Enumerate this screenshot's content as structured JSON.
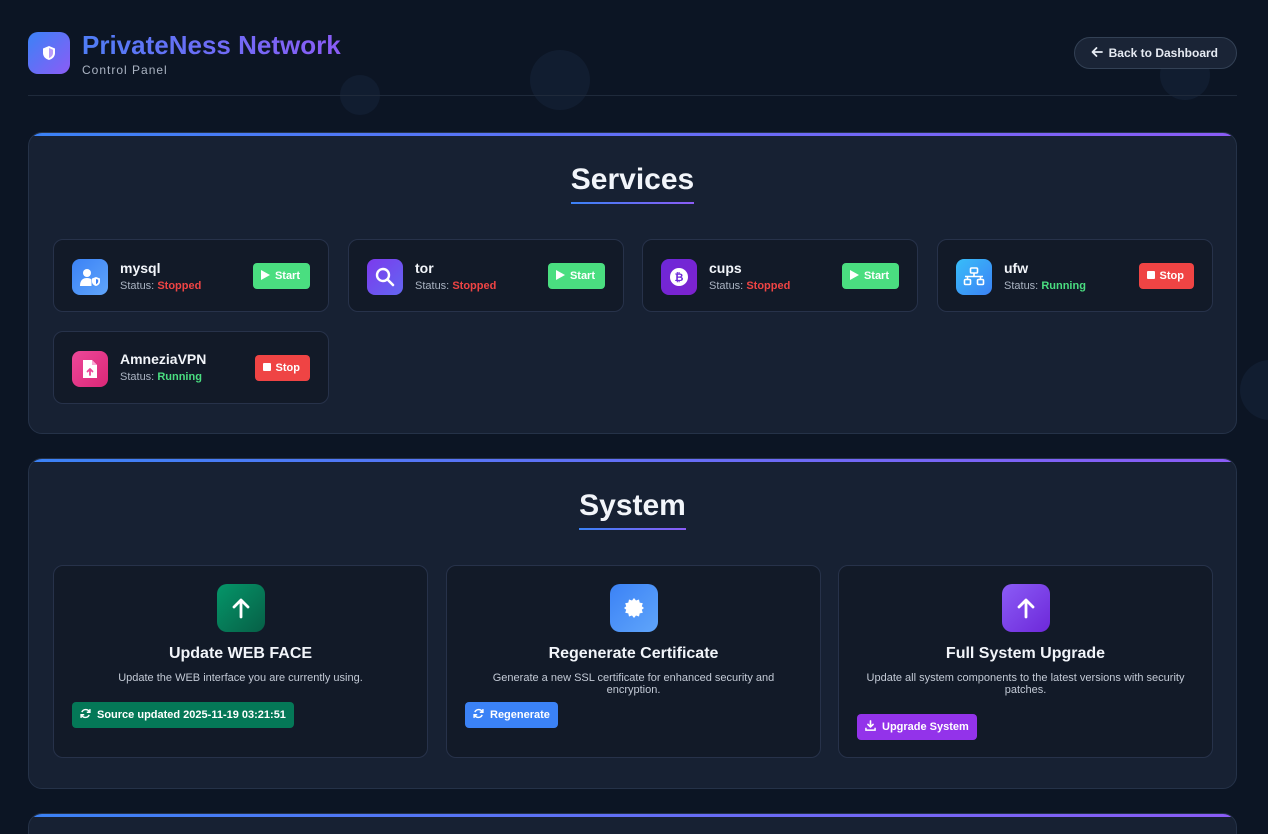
{
  "header": {
    "title": "PrivateNess Network",
    "subtitle": "Control Panel",
    "back_label": "Back to Dashboard"
  },
  "services": {
    "title": "Services",
    "status_prefix": "Status:",
    "items": [
      {
        "name": "mysql",
        "status": "Stopped",
        "action": "Start",
        "icon": "user-shield-icon",
        "color": "#3b82f6"
      },
      {
        "name": "tor",
        "status": "Stopped",
        "action": "Start",
        "icon": "search-icon",
        "color": "#7c3aed"
      },
      {
        "name": "cups",
        "status": "Stopped",
        "action": "Start",
        "icon": "bitcoin-icon",
        "color": "#6d28d9"
      },
      {
        "name": "ufw",
        "status": "Running",
        "action": "Stop",
        "icon": "network-icon",
        "color": "#38bdf8"
      },
      {
        "name": "AmneziaVPN",
        "status": "Running",
        "action": "Stop",
        "icon": "file-upload-icon",
        "color": "#ec4899"
      }
    ]
  },
  "system": {
    "title": "System",
    "cards": [
      {
        "title": "Update WEB FACE",
        "description": "Update the WEB interface you are currently using.",
        "button": "Source updated 2025-11-19 03:21:51",
        "icon": "arrow-up-icon",
        "color": "#047857",
        "button_color": "#047857"
      },
      {
        "title": "Regenerate Certificate",
        "description": "Generate a new SSL certificate for enhanced security and encryption.",
        "button": "Regenerate",
        "icon": "certificate-icon",
        "color": "#3b82f6",
        "button_color": "#3b82f6"
      },
      {
        "title": "Full System Upgrade",
        "description": "Update all system components to the latest versions with security patches.",
        "button": "Upgrade System",
        "icon": "arrow-up-icon",
        "color": "#7c3aed",
        "button_color": "#9333ea"
      }
    ]
  }
}
